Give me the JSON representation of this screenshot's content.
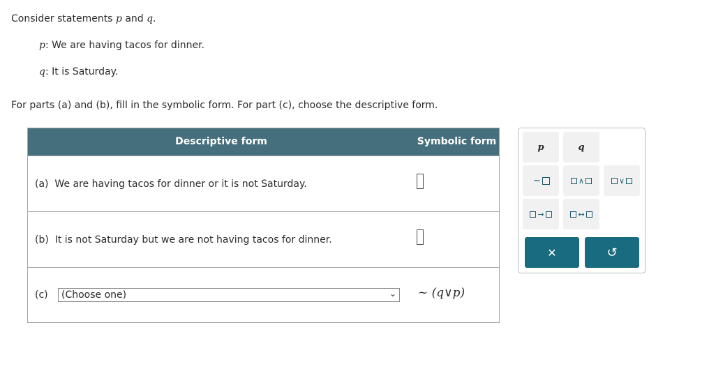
{
  "intro": {
    "prefix": "Consider statements ",
    "p": "p",
    "and": " and ",
    "q": "q",
    "suffix": "."
  },
  "statements": {
    "p_var": "p",
    "p_sep": ": ",
    "p_text": "We are having tacos for dinner.",
    "q_var": "q",
    "q_sep": ": ",
    "q_text": "It is Saturday."
  },
  "instructions": "For parts (a) and (b), fill in the symbolic form. For part (c), choose the descriptive form.",
  "table": {
    "header_desc": "Descriptive form",
    "header_sym": "Symbolic form",
    "rows": [
      {
        "label": "(a)",
        "text": "We are having tacos for dinner or it is not Saturday."
      },
      {
        "label": "(b)",
        "text": "It is not Saturday but we are not having tacos for dinner."
      },
      {
        "label": "(c)",
        "select_value": "(Choose one)",
        "symbolic": "~ (q∨p)"
      }
    ]
  },
  "keypad": {
    "p": "p",
    "q": "q",
    "not_op": "~",
    "and_op": "∧",
    "or_op": "∨",
    "implies_op": "→",
    "iff_op": "↔",
    "clear": "✕",
    "undo": "↺",
    "colors": {
      "panel_border": "#b6c0c6",
      "button": "#196c7f",
      "header": "#456f7d"
    }
  }
}
